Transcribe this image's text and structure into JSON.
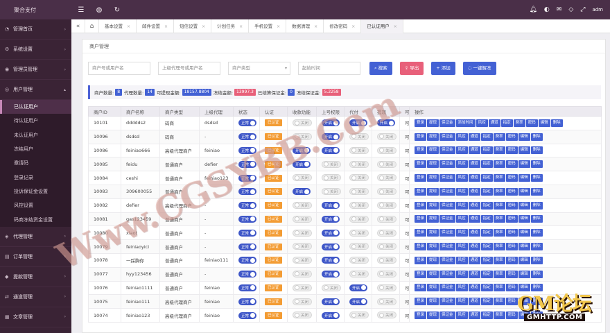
{
  "topbar": {
    "brand": "聚合支付",
    "user": "adm"
  },
  "sidebar": {
    "items": [
      {
        "label": "管理首页",
        "icon": "gauge-icon"
      },
      {
        "label": "系统设置",
        "icon": "gear-icon"
      },
      {
        "label": "管理员管理",
        "icon": "user-icon"
      },
      {
        "label": "用户管理",
        "icon": "users-icon",
        "expanded": true
      }
    ],
    "sub_items": [
      {
        "label": "已认证用户",
        "active": true
      },
      {
        "label": "待认证用户"
      },
      {
        "label": "未认证用户"
      },
      {
        "label": "冻结用户"
      },
      {
        "label": "邀请码"
      },
      {
        "label": "登录记录"
      },
      {
        "label": "投诉保证金设置"
      },
      {
        "label": "风控设置"
      },
      {
        "label": "码商冻结资金设置"
      }
    ],
    "bottom_items": [
      {
        "label": "代理管理",
        "icon": "agent-icon"
      },
      {
        "label": "订单管理",
        "icon": "order-icon"
      },
      {
        "label": "提款管理",
        "icon": "withdraw-icon"
      },
      {
        "label": "通道管理",
        "icon": "channel-icon"
      },
      {
        "label": "文章管理",
        "icon": "article-icon"
      }
    ]
  },
  "tabs": [
    {
      "label": "基本设置"
    },
    {
      "label": "邮件设置"
    },
    {
      "label": "短信设置"
    },
    {
      "label": "计划任务"
    },
    {
      "label": "手机设置"
    },
    {
      "label": "数据清理"
    },
    {
      "label": "修改密码"
    },
    {
      "label": "已认证用户",
      "active": true
    }
  ],
  "panel": {
    "title": "商户管理"
  },
  "filters": {
    "merchant_placeholder": "商户号或用户名",
    "agent_placeholder": "上级代理号或用户名",
    "type_placeholder": "商户类型",
    "time_placeholder": "起始时间",
    "search_label": "搜索",
    "export_label": "导出",
    "add_label": "添加",
    "extra_label": "一键解冻"
  },
  "stats": {
    "merchant_count_label": "商户数量:",
    "merchant_count": "8",
    "agent_count_label": "代理数量:",
    "agent_count": "14",
    "withdrawable_label": "可提现金额:",
    "withdrawable": "18157.8804",
    "frozen_label": "冻结金额:",
    "frozen": "13997.3",
    "settled_deposit_label": "已结算保证金:",
    "settled_deposit": "0",
    "frozen_deposit_label": "冻结保证金:",
    "frozen_deposit": "5.2258"
  },
  "table": {
    "headers": [
      "商户ID",
      "商户名称",
      "商户类型",
      "上级代理",
      "状态",
      "认证",
      "收款功能",
      "上号权限",
      "代付",
      "提现",
      "可",
      "操作"
    ],
    "status_label": "正常",
    "verified_label": "已认证",
    "on_label": "开启",
    "off_label": "关闭",
    "cut_label": "可",
    "ops": [
      "登录",
      "提现",
      "保证金",
      "风控",
      "通道",
      "指定",
      "费率",
      "密码",
      "编辑",
      "删除"
    ],
    "ops_first": [
      "登录",
      "提现",
      "保证金",
      "添加时间",
      "风控",
      "通道",
      "指定",
      "费率",
      "密码",
      "编辑",
      "删除"
    ],
    "rows": [
      {
        "id": "10101",
        "name": "ddddds2",
        "type": "码商",
        "agent": "dsdsd",
        "collect": false,
        "upper": true,
        "payout": true,
        "withdraw": true
      },
      {
        "id": "10096",
        "name": "dsdsd",
        "type": "码商",
        "agent": "-",
        "collect": false,
        "upper": true,
        "payout": false,
        "withdraw": false
      },
      {
        "id": "10086",
        "name": "feiniao666",
        "type": "高级代理商户",
        "agent": "feiniao",
        "collect": true,
        "upper": true,
        "payout": false,
        "withdraw": false
      },
      {
        "id": "10085",
        "name": "feidu",
        "type": "普通商户",
        "agent": "defier",
        "collect": true,
        "upper": false,
        "payout": false,
        "withdraw": false
      },
      {
        "id": "10084",
        "name": "ceshi",
        "type": "普通商户",
        "agent": "feiniao123",
        "collect": false,
        "upper": false,
        "payout": false,
        "withdraw": false
      },
      {
        "id": "10083",
        "name": "309600055",
        "type": "普通商户",
        "agent": "-",
        "collect": true,
        "upper": false,
        "payout": false,
        "withdraw": false
      },
      {
        "id": "10082",
        "name": "defier",
        "type": "高级代理商户",
        "agent": "-",
        "collect": false,
        "upper": true,
        "payout": false,
        "withdraw": false
      },
      {
        "id": "10081",
        "name": "gas123459",
        "type": "普通商户",
        "agent": "-",
        "collect": false,
        "upper": true,
        "payout": false,
        "withdraw": false
      },
      {
        "id": "10080",
        "name": "xiaot",
        "type": "普通商户",
        "agent": "-",
        "collect": false,
        "upper": true,
        "payout": false,
        "withdraw": false
      },
      {
        "id": "10079",
        "name": "feiniaoyici",
        "type": "普通商户",
        "agent": "-",
        "collect": false,
        "upper": true,
        "payout": false,
        "withdraw": false
      },
      {
        "id": "10078",
        "name": "一踩胸你",
        "type": "普通商户",
        "agent": "feiniao111",
        "collect": false,
        "upper": true,
        "payout": false,
        "withdraw": false
      },
      {
        "id": "10077",
        "name": "hyy123456",
        "type": "普通商户",
        "agent": "-",
        "collect": false,
        "upper": true,
        "payout": false,
        "withdraw": false
      },
      {
        "id": "10076",
        "name": "feiniao1111",
        "type": "普通商户",
        "agent": "feiniao",
        "collect": false,
        "upper": false,
        "payout": true,
        "withdraw": false
      },
      {
        "id": "10075",
        "name": "feiniao111",
        "type": "高级代理商户",
        "agent": "feiniao",
        "collect": false,
        "upper": true,
        "payout": true,
        "withdraw": false
      },
      {
        "id": "10074",
        "name": "feiniao123",
        "type": "高级代理商户",
        "agent": "feiniao",
        "collect": false,
        "upper": true,
        "payout": false,
        "withdraw": false
      }
    ]
  },
  "watermark": {
    "text": "Www.CGSYBB.Com",
    "logo_main": "GM论坛",
    "logo_sub": "GMHTTP.COM"
  },
  "colors": {
    "topbar": "#4a2f48",
    "sidebar": "#3a2335",
    "primary": "#4361d4",
    "verified": "#f39c34",
    "export": "#e8607a"
  }
}
